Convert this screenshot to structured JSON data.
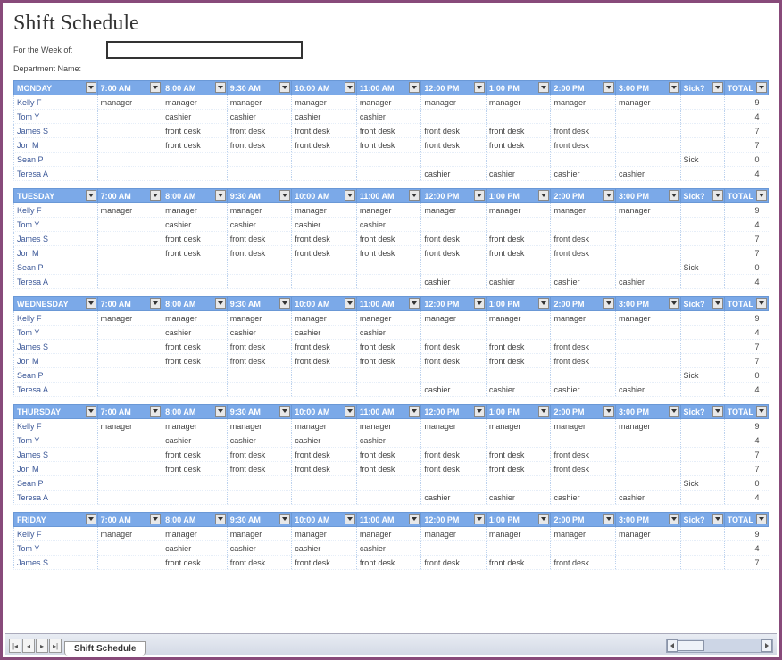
{
  "title": "Shift Schedule",
  "labels": {
    "week_of": "For the Week of:",
    "department": "Department Name:"
  },
  "columns": [
    "7:00 AM",
    "8:00 AM",
    "9:30 AM",
    "10:00 AM",
    "11:00 AM",
    "12:00 PM",
    "1:00 PM",
    "2:00 PM",
    "3:00 PM"
  ],
  "sick_header": "Sick?",
  "total_header": "TOTAL",
  "days": [
    {
      "name": "MONDAY",
      "rows": [
        {
          "emp": "Kelly F",
          "cells": [
            "manager",
            "manager",
            "manager",
            "manager",
            "manager",
            "manager",
            "manager",
            "manager",
            "manager"
          ],
          "sick": "",
          "total": "9"
        },
        {
          "emp": "Tom Y",
          "cells": [
            "",
            "cashier",
            "cashier",
            "cashier",
            "cashier",
            "",
            "",
            "",
            ""
          ],
          "sick": "",
          "total": "4"
        },
        {
          "emp": "James S",
          "cells": [
            "",
            "front desk",
            "front desk",
            "front desk",
            "front desk",
            "front desk",
            "front desk",
            "front desk",
            ""
          ],
          "sick": "",
          "total": "7"
        },
        {
          "emp": "Jon M",
          "cells": [
            "",
            "front desk",
            "front desk",
            "front desk",
            "front desk",
            "front desk",
            "front desk",
            "front desk",
            ""
          ],
          "sick": "",
          "total": "7"
        },
        {
          "emp": "Sean P",
          "cells": [
            "",
            "",
            "",
            "",
            "",
            "",
            "",
            "",
            ""
          ],
          "sick": "Sick",
          "total": "0"
        },
        {
          "emp": "Teresa A",
          "cells": [
            "",
            "",
            "",
            "",
            "",
            "cashier",
            "cashier",
            "cashier",
            "cashier"
          ],
          "sick": "",
          "total": "4"
        }
      ]
    },
    {
      "name": "TUESDAY",
      "rows": [
        {
          "emp": "Kelly F",
          "cells": [
            "manager",
            "manager",
            "manager",
            "manager",
            "manager",
            "manager",
            "manager",
            "manager",
            "manager"
          ],
          "sick": "",
          "total": "9"
        },
        {
          "emp": "Tom Y",
          "cells": [
            "",
            "cashier",
            "cashier",
            "cashier",
            "cashier",
            "",
            "",
            "",
            ""
          ],
          "sick": "",
          "total": "4"
        },
        {
          "emp": "James S",
          "cells": [
            "",
            "front desk",
            "front desk",
            "front desk",
            "front desk",
            "front desk",
            "front desk",
            "front desk",
            ""
          ],
          "sick": "",
          "total": "7"
        },
        {
          "emp": "Jon M",
          "cells": [
            "",
            "front desk",
            "front desk",
            "front desk",
            "front desk",
            "front desk",
            "front desk",
            "front desk",
            ""
          ],
          "sick": "",
          "total": "7"
        },
        {
          "emp": "Sean P",
          "cells": [
            "",
            "",
            "",
            "",
            "",
            "",
            "",
            "",
            ""
          ],
          "sick": "Sick",
          "total": "0"
        },
        {
          "emp": "Teresa A",
          "cells": [
            "",
            "",
            "",
            "",
            "",
            "cashier",
            "cashier",
            "cashier",
            "cashier"
          ],
          "sick": "",
          "total": "4"
        }
      ]
    },
    {
      "name": "WEDNESDAY",
      "rows": [
        {
          "emp": "Kelly F",
          "cells": [
            "manager",
            "manager",
            "manager",
            "manager",
            "manager",
            "manager",
            "manager",
            "manager",
            "manager"
          ],
          "sick": "",
          "total": "9"
        },
        {
          "emp": "Tom Y",
          "cells": [
            "",
            "cashier",
            "cashier",
            "cashier",
            "cashier",
            "",
            "",
            "",
            ""
          ],
          "sick": "",
          "total": "4"
        },
        {
          "emp": "James S",
          "cells": [
            "",
            "front desk",
            "front desk",
            "front desk",
            "front desk",
            "front desk",
            "front desk",
            "front desk",
            ""
          ],
          "sick": "",
          "total": "7"
        },
        {
          "emp": "Jon M",
          "cells": [
            "",
            "front desk",
            "front desk",
            "front desk",
            "front desk",
            "front desk",
            "front desk",
            "front desk",
            ""
          ],
          "sick": "",
          "total": "7"
        },
        {
          "emp": "Sean P",
          "cells": [
            "",
            "",
            "",
            "",
            "",
            "",
            "",
            "",
            ""
          ],
          "sick": "Sick",
          "total": "0"
        },
        {
          "emp": "Teresa A",
          "cells": [
            "",
            "",
            "",
            "",
            "",
            "cashier",
            "cashier",
            "cashier",
            "cashier"
          ],
          "sick": "",
          "total": "4"
        }
      ]
    },
    {
      "name": "THURSDAY",
      "rows": [
        {
          "emp": "Kelly F",
          "cells": [
            "manager",
            "manager",
            "manager",
            "manager",
            "manager",
            "manager",
            "manager",
            "manager",
            "manager"
          ],
          "sick": "",
          "total": "9"
        },
        {
          "emp": "Tom Y",
          "cells": [
            "",
            "cashier",
            "cashier",
            "cashier",
            "cashier",
            "",
            "",
            "",
            ""
          ],
          "sick": "",
          "total": "4"
        },
        {
          "emp": "James S",
          "cells": [
            "",
            "front desk",
            "front desk",
            "front desk",
            "front desk",
            "front desk",
            "front desk",
            "front desk",
            ""
          ],
          "sick": "",
          "total": "7"
        },
        {
          "emp": "Jon M",
          "cells": [
            "",
            "front desk",
            "front desk",
            "front desk",
            "front desk",
            "front desk",
            "front desk",
            "front desk",
            ""
          ],
          "sick": "",
          "total": "7"
        },
        {
          "emp": "Sean P",
          "cells": [
            "",
            "",
            "",
            "",
            "",
            "",
            "",
            "",
            ""
          ],
          "sick": "Sick",
          "total": "0"
        },
        {
          "emp": "Teresa A",
          "cells": [
            "",
            "",
            "",
            "",
            "",
            "cashier",
            "cashier",
            "cashier",
            "cashier"
          ],
          "sick": "",
          "total": "4"
        }
      ]
    },
    {
      "name": "FRIDAY",
      "rows": [
        {
          "emp": "Kelly F",
          "cells": [
            "manager",
            "manager",
            "manager",
            "manager",
            "manager",
            "manager",
            "manager",
            "manager",
            "manager"
          ],
          "sick": "",
          "total": "9"
        },
        {
          "emp": "Tom Y",
          "cells": [
            "",
            "cashier",
            "cashier",
            "cashier",
            "cashier",
            "",
            "",
            "",
            ""
          ],
          "sick": "",
          "total": "4"
        },
        {
          "emp": "James S",
          "cells": [
            "",
            "front desk",
            "front desk",
            "front desk",
            "front desk",
            "front desk",
            "front desk",
            "front desk",
            ""
          ],
          "sick": "",
          "total": "7"
        }
      ]
    }
  ],
  "tab": {
    "sheet_name": "Shift Schedule"
  }
}
